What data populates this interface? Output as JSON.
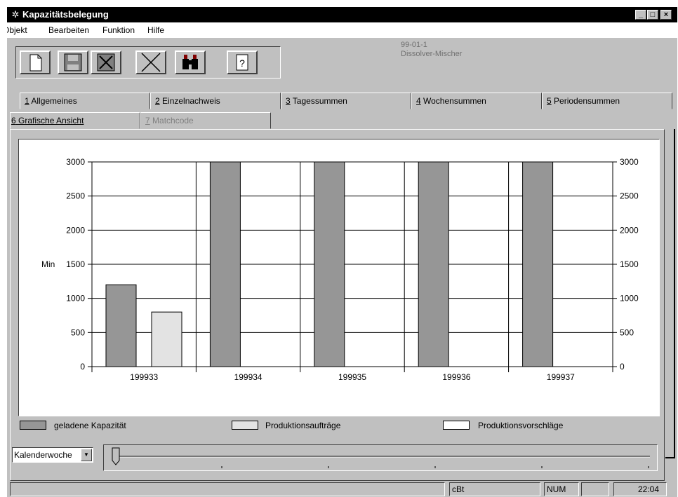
{
  "window": {
    "title": "Kapazitätsbelegung",
    "icon": "app-icon"
  },
  "menu": [
    "Objekt",
    "Bearbeiten",
    "Funktion",
    "Hilfe"
  ],
  "toolbar": {
    "buttons": [
      "new-document-icon",
      "save-icon",
      "save-close-icon",
      "delete-icon",
      "search-binoculars-icon",
      "help-icon"
    ],
    "help_label": "?"
  },
  "record": {
    "id": "99-01-1",
    "name": "Dissolver-Mischer"
  },
  "tabs": {
    "row1": [
      {
        "num": "1",
        "label": " Allgemeines"
      },
      {
        "num": "2",
        "label": " Einzelnachweis"
      },
      {
        "num": "3",
        "label": " Tagessummen"
      },
      {
        "num": "4",
        "label": " Wochensummen"
      },
      {
        "num": "5",
        "label": " Periodensummen"
      }
    ],
    "row2": [
      {
        "num": "6",
        "label": " Grafische Ansicht"
      },
      {
        "num": "7",
        "label": " Matchcode"
      }
    ]
  },
  "chart_data": {
    "type": "bar",
    "categories": [
      "199933",
      "199934",
      "199935",
      "199936",
      "199937"
    ],
    "series": [
      {
        "name": "geladene Kapazität",
        "values": [
          1200,
          3000,
          3000,
          3000,
          3000
        ],
        "color": "#969696"
      },
      {
        "name": "Produktionsaufträge",
        "values": [
          800,
          0,
          0,
          0,
          0
        ],
        "color": "#e3e3e3"
      },
      {
        "name": "Produktionsvorschläge",
        "values": [
          0,
          0,
          0,
          0,
          0
        ],
        "color": "#ffffff"
      }
    ],
    "ylabel": "Min",
    "ylim": [
      0,
      3000
    ],
    "yticks": [
      "0",
      "500",
      "1000",
      "1500",
      "2000",
      "2500",
      "3000"
    ],
    "grid": true,
    "legend": "bottom"
  },
  "controls": {
    "period_select": "Kalenderwoche"
  },
  "statusbar": {
    "field1": "",
    "field2": "cBt",
    "field3": "NUM",
    "field4": "",
    "time": "22:04"
  }
}
